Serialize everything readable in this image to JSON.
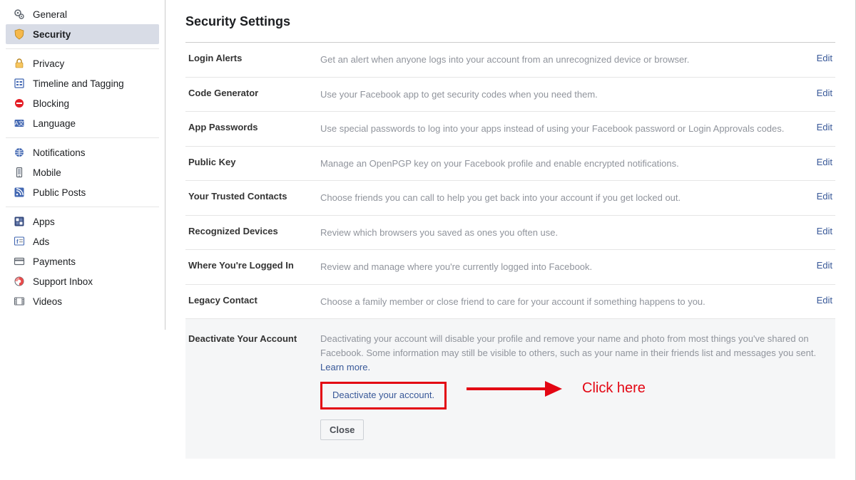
{
  "sidebar": {
    "groups": [
      {
        "items": [
          {
            "id": "general",
            "label": "General",
            "icon": "gears"
          },
          {
            "id": "security",
            "label": "Security",
            "icon": "shield",
            "active": true
          }
        ]
      },
      {
        "items": [
          {
            "id": "privacy",
            "label": "Privacy",
            "icon": "lock"
          },
          {
            "id": "timeline",
            "label": "Timeline and Tagging",
            "icon": "timeline"
          },
          {
            "id": "blocking",
            "label": "Blocking",
            "icon": "block"
          },
          {
            "id": "language",
            "label": "Language",
            "icon": "lang"
          }
        ]
      },
      {
        "items": [
          {
            "id": "notifications",
            "label": "Notifications",
            "icon": "globe"
          },
          {
            "id": "mobile",
            "label": "Mobile",
            "icon": "mobile"
          },
          {
            "id": "publicposts",
            "label": "Public Posts",
            "icon": "rss"
          }
        ]
      },
      {
        "items": [
          {
            "id": "apps",
            "label": "Apps",
            "icon": "apps"
          },
          {
            "id": "ads",
            "label": "Ads",
            "icon": "ads"
          },
          {
            "id": "payments",
            "label": "Payments",
            "icon": "card"
          },
          {
            "id": "support",
            "label": "Support Inbox",
            "icon": "support"
          },
          {
            "id": "videos",
            "label": "Videos",
            "icon": "video"
          }
        ]
      }
    ]
  },
  "main": {
    "title": "Security Settings",
    "rows": [
      {
        "label": "Login Alerts",
        "desc": "Get an alert when anyone logs into your account from an unrecognized device or browser.",
        "action": "Edit"
      },
      {
        "label": "Code Generator",
        "desc": "Use your Facebook app to get security codes when you need them.",
        "action": "Edit"
      },
      {
        "label": "App Passwords",
        "desc": "Use special passwords to log into your apps instead of using your Facebook password or Login Approvals codes.",
        "action": "Edit"
      },
      {
        "label": "Public Key",
        "desc": "Manage an OpenPGP key on your Facebook profile and enable encrypted notifications.",
        "action": "Edit"
      },
      {
        "label": "Your Trusted Contacts",
        "desc": "Choose friends you can call to help you get back into your account if you get locked out.",
        "action": "Edit"
      },
      {
        "label": "Recognized Devices",
        "desc": "Review which browsers you saved as ones you often use.",
        "action": "Edit"
      },
      {
        "label": "Where You're Logged In",
        "desc": "Review and manage where you're currently logged into Facebook.",
        "action": "Edit"
      },
      {
        "label": "Legacy Contact",
        "desc": "Choose a family member or close friend to care for your account if something happens to you.",
        "action": "Edit"
      }
    ],
    "deactivate": {
      "label": "Deactivate Your Account",
      "desc": "Deactivating your account will disable your profile and remove your name and photo from most things you've shared on Facebook. Some information may still be visible to others, such as your name in their friends list and messages you sent. ",
      "learn": "Learn more.",
      "link": "Deactivate your account.",
      "close": "Close"
    },
    "annotation": "Click here"
  }
}
